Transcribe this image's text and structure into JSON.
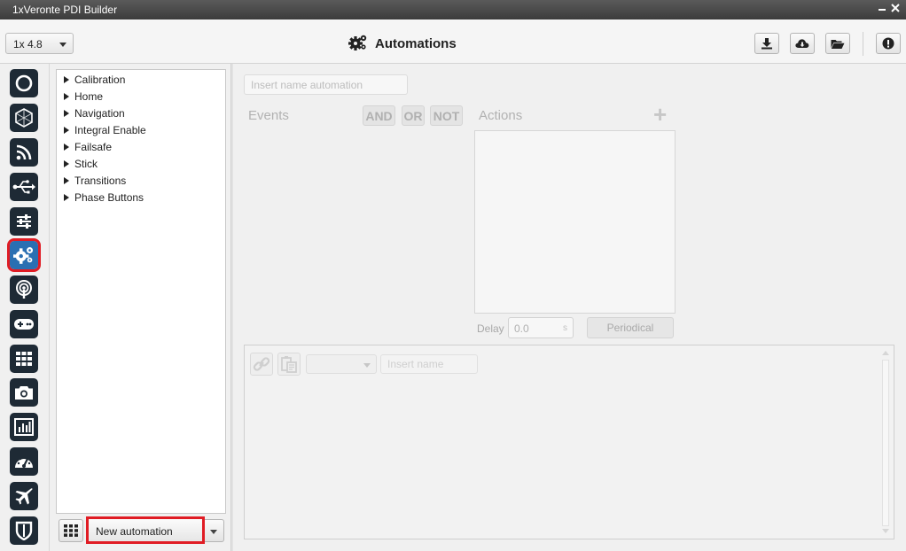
{
  "window": {
    "title": "1xVeronte PDI Builder"
  },
  "header": {
    "version": "1x 4.8",
    "page_title": "Automations"
  },
  "tree": {
    "items": [
      {
        "label": "Calibration"
      },
      {
        "label": "Home"
      },
      {
        "label": "Navigation"
      },
      {
        "label": "Integral Enable"
      },
      {
        "label": "Failsafe"
      },
      {
        "label": "Stick"
      },
      {
        "label": "Transitions"
      },
      {
        "label": "Phase Buttons"
      }
    ]
  },
  "footer": {
    "new_automation_label": "New automation"
  },
  "editor": {
    "name_placeholder": "Insert name automation",
    "events_label": "Events",
    "actions_label": "Actions",
    "logic": {
      "and": "AND",
      "or": "OR",
      "not": "NOT"
    },
    "add_symbol": "+",
    "delay_label": "Delay",
    "delay_value": "0.0",
    "delay_unit": "s",
    "periodical_label": "Periodical",
    "bottom_name_placeholder": "Insert name"
  },
  "colors": {
    "sidebar_icon_bg": "#1e2a35",
    "active_icon_bg": "#2a6fb2",
    "highlight_red": "#e01c24"
  }
}
